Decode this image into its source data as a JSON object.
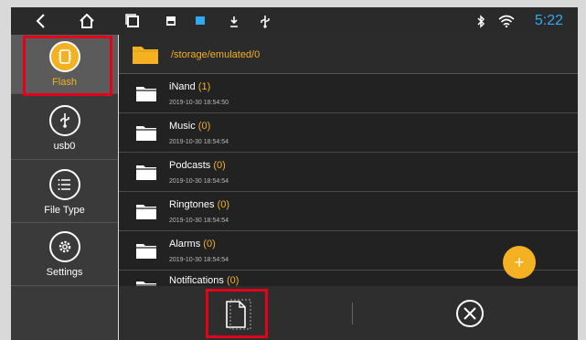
{
  "status_bar": {
    "icons": [
      "back-icon",
      "home-icon",
      "recent-apps-icon",
      "image-notification-icon",
      "flag-notification-icon",
      "download-icon",
      "usb-icon",
      "bluetooth-icon",
      "wifi-icon"
    ],
    "time": "5:22",
    "time_color": "#31a9f2"
  },
  "sidebar": {
    "items": [
      {
        "label": "Flash",
        "icon": "flash-memory-icon",
        "active": true
      },
      {
        "label": "usb0",
        "icon": "usb-drive-icon",
        "active": false
      },
      {
        "label": "File Type",
        "icon": "file-type-list-icon",
        "active": false
      },
      {
        "label": "Settings",
        "icon": "settings-gear-icon",
        "active": false
      }
    ]
  },
  "main": {
    "path": "/storage/emulated/0",
    "folders": [
      {
        "name": "iNand",
        "count": "(1)",
        "date": "2019-10-30 18:54:50"
      },
      {
        "name": "Music",
        "count": "(0)",
        "date": "2019-10-30 18:54:54"
      },
      {
        "name": "Podcasts",
        "count": "(0)",
        "date": "2019-10-30 18:54:54"
      },
      {
        "name": "Ringtones",
        "count": "(0)",
        "date": "2019-10-30 18:54:54"
      },
      {
        "name": "Alarms",
        "count": "(0)",
        "date": "2019-10-30 18:54:54"
      },
      {
        "name": "Notifications",
        "count": "(0)",
        "date": ""
      }
    ],
    "fab_label": "+"
  },
  "bottom_bar": {
    "buttons": [
      "select-file-icon",
      "close-circle-icon"
    ]
  },
  "colors": {
    "accent": "#f4b222",
    "highlight_box": "#e3001b",
    "background": "#222222"
  }
}
